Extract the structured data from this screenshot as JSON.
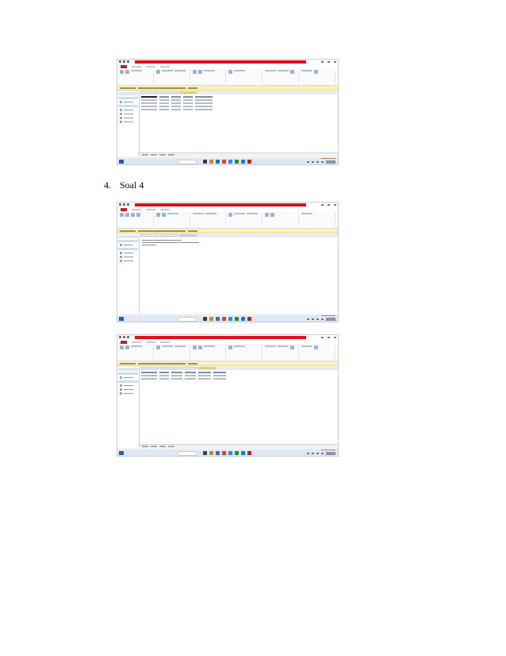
{
  "caption": {
    "number": "4.",
    "text": "Soal 4"
  },
  "colors": {
    "access_red": "#e0101b",
    "warning_bar": "#fdf1b6",
    "taskbar": "#dfe7f2"
  },
  "screenshots": [
    {
      "name": "access-table-view",
      "content": "table"
    },
    {
      "name": "access-query-sql-view",
      "content": "sql"
    },
    {
      "name": "access-query-result-view",
      "content": "table"
    }
  ]
}
